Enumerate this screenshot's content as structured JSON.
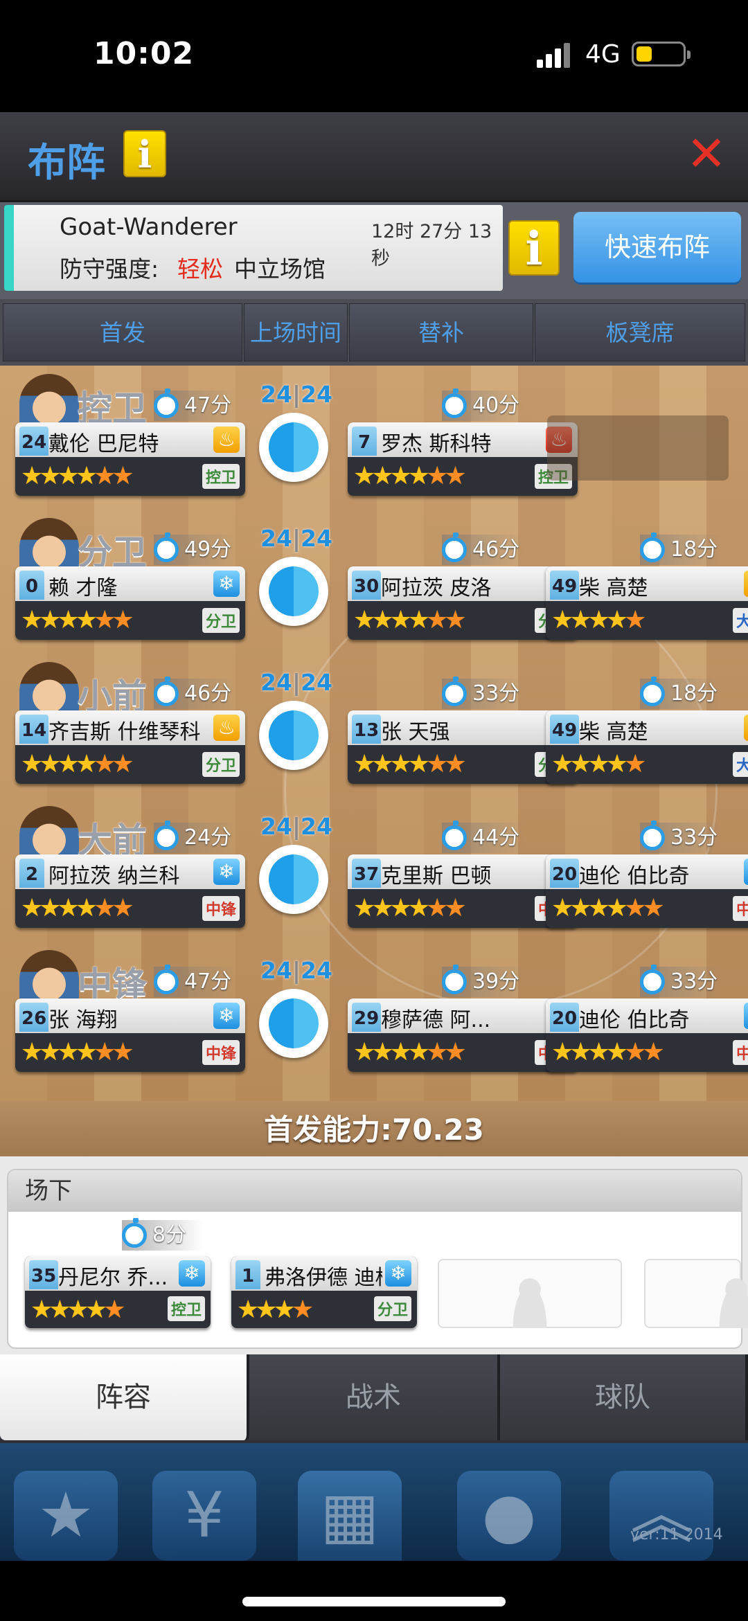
{
  "status_bar": {
    "time": "10:02",
    "network": "4G"
  },
  "top_bar": {
    "title": "布阵",
    "info_icon": "info-icon",
    "close_icon": "close-x-icon"
  },
  "header": {
    "team_name": "Goat-Wanderer",
    "timer": "12时 27分 13秒",
    "defense_label": "防守强度:",
    "defense_value": "轻松",
    "venue": "中立场馆",
    "quick_button": "快速布阵"
  },
  "top_tabs": [
    "首发",
    "上场时间",
    "替补",
    "板凳席"
  ],
  "rows": [
    {
      "pos": "控卫",
      "ratio_left": "24",
      "ratio_right": "24",
      "starter": {
        "mins": "47分",
        "num": "24",
        "name": "戴伦 巴尼特",
        "badge": "gold",
        "badge_icon": "flame-icon",
        "stars": "★★★★",
        "half": "★★",
        "pos": "控卫",
        "pcolor": "green"
      },
      "sub1": {
        "mins": "40分",
        "num": "7",
        "name": "罗杰 斯科特",
        "badge": "red",
        "badge_icon": "flame-icon",
        "stars": "★★★★",
        "half": "★★",
        "pos": "控卫",
        "pcolor": "green"
      },
      "sub2": null
    },
    {
      "pos": "分卫",
      "ratio_left": "24",
      "ratio_right": "24",
      "starter": {
        "mins": "49分",
        "num": "0",
        "name": "赖 才隆",
        "badge": "blue",
        "badge_icon": "snowflake-icon",
        "stars": "★★★★",
        "half": "★★",
        "pos": "分卫",
        "pcolor": "green"
      },
      "sub1": {
        "mins": "46分",
        "num": "30",
        "name": "阿拉茨 皮洛",
        "badge": "blue",
        "badge_icon": "snowflake-icon",
        "stars": "★★★★",
        "half": "★★",
        "pos": "分卫",
        "pcolor": "green"
      },
      "sub2": {
        "mins": "18分",
        "num": "49",
        "name": "柴 高楚",
        "badge": "gold",
        "badge_icon": "flame-icon",
        "stars": "★★★★",
        "half": "★",
        "pos": "大前",
        "pcolor": "blue"
      }
    },
    {
      "pos": "小前",
      "ratio_left": "24",
      "ratio_right": "24",
      "starter": {
        "mins": "46分",
        "num": "14",
        "name": "齐吉斯 什维琴科",
        "badge": "gold",
        "badge_icon": "flame-icon",
        "stars": "★★★★",
        "half": "★★",
        "pos": "分卫",
        "pcolor": "green"
      },
      "sub1": {
        "mins": "33分",
        "num": "13",
        "name": "张 天强",
        "badge": "orange",
        "badge_icon": "flame-icon",
        "stars": "★★★★",
        "half": "★★",
        "pos": "分卫",
        "pcolor": "green"
      },
      "sub2": {
        "mins": "18分",
        "num": "49",
        "name": "柴 高楚",
        "badge": "gold",
        "badge_icon": "flame-icon",
        "stars": "★★★★",
        "half": "★",
        "pos": "大前",
        "pcolor": "blue"
      }
    },
    {
      "pos": "大前",
      "ratio_left": "24",
      "ratio_right": "24",
      "starter": {
        "mins": "24分",
        "num": "2",
        "name": "阿拉茨 纳兰科",
        "badge": "blue",
        "badge_icon": "snowflake-icon",
        "stars": "★★★★",
        "half": "★★",
        "pos": "中锋",
        "pcolor": "red"
      },
      "sub1": {
        "mins": "44分",
        "num": "37",
        "name": "克里斯 巴顿",
        "badge": "blue",
        "badge_icon": "snowflake-icon",
        "stars": "★★★★",
        "half": "★★",
        "pos": "中锋",
        "pcolor": "red"
      },
      "sub2": {
        "mins": "33分",
        "num": "20",
        "name": "迪伦 伯比奇",
        "badge": "blue",
        "badge_icon": "snowflake-icon",
        "stars": "★★★★",
        "half": "★★",
        "pos": "中锋",
        "pcolor": "red"
      }
    },
    {
      "pos": "中锋",
      "ratio_left": "24",
      "ratio_right": "24",
      "starter": {
        "mins": "47分",
        "num": "26",
        "name": "张 海翔",
        "badge": "blue",
        "badge_icon": "snowflake-icon",
        "stars": "★★★★",
        "half": "★★",
        "pos": "中锋",
        "pcolor": "red"
      },
      "sub1": {
        "mins": "39分",
        "num": "29",
        "name": "穆萨德 阿...",
        "badge": "gold",
        "badge_icon": "flame-icon",
        "stars": "★★★★",
        "half": "★★",
        "pos": "中锋",
        "pcolor": "red"
      },
      "sub2": {
        "mins": "33分",
        "num": "20",
        "name": "迪伦 伯比奇",
        "badge": "blue",
        "badge_icon": "snowflake-icon",
        "stars": "★★★★",
        "half": "★★",
        "pos": "中锋",
        "pcolor": "red"
      }
    }
  ],
  "starting_power": "首发能力:70.23",
  "bench": {
    "title": "场下",
    "players": [
      {
        "mins": "8分",
        "num": "35",
        "name": "丹尼尔 乔...",
        "badge": "blue",
        "badge_icon": "snowflake-icon",
        "stars": "★★★★",
        "half": "★",
        "pos": "控卫",
        "pcolor": "green"
      },
      {
        "mins": "",
        "num": "1",
        "name": "弗洛伊德 迪格尔",
        "badge": "blue",
        "badge_icon": "snowflake-icon",
        "stars": "★★★",
        "half": "★",
        "pos": "分卫",
        "pcolor": "green"
      }
    ]
  },
  "bottom_tabs": [
    "阵容",
    "战术",
    "球队"
  ],
  "version": "ver:11  2014",
  "colors": {
    "accent": "#4f9fe8",
    "danger": "#e53026",
    "info_yellow": "#ffe000",
    "quick_button": "#3592e5"
  }
}
